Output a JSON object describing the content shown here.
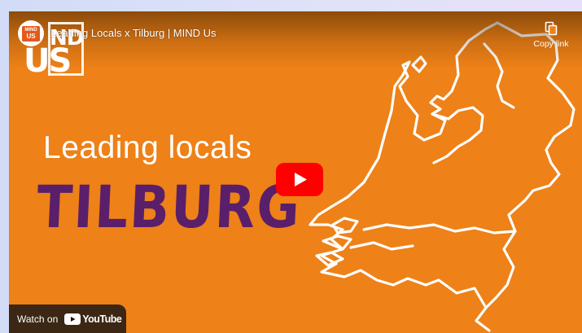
{
  "player": {
    "title": "Leading Locals x Tilburg | MIND Us",
    "channel_avatar_text": [
      "MIND",
      "US"
    ],
    "logo_text": [
      "ND",
      "US"
    ],
    "copy_link_label": "Copy link",
    "headline": "Leading locals",
    "city": "TILBURG",
    "watch_on_label": "Watch on",
    "youtube_label": "YouTube"
  },
  "colors": {
    "background_orange": "#ee8117",
    "city_text_purple": "#5a1f6a",
    "play_red": "#ff0000"
  },
  "icons": [
    "copy-icon",
    "play-icon",
    "youtube-logo-icon",
    "netherlands-map-outline"
  ]
}
